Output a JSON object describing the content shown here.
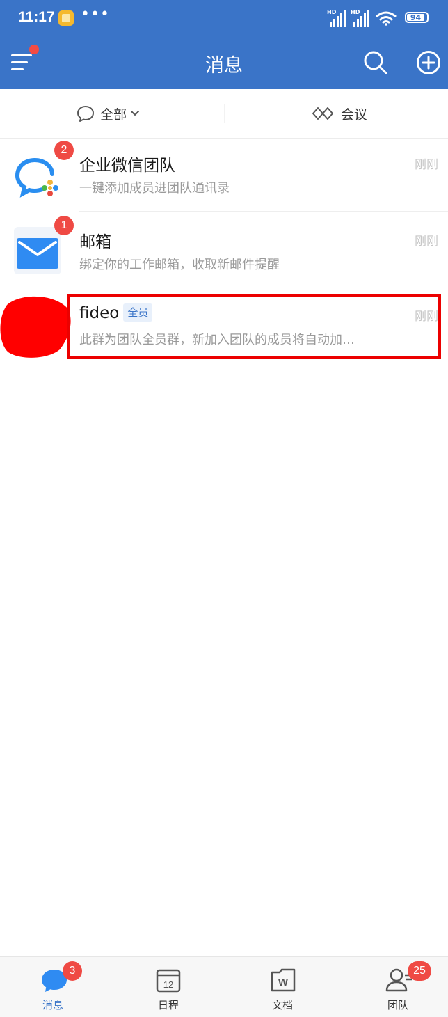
{
  "status_bar": {
    "time": "11:17",
    "dots": "•••",
    "signal_label_1": "HD",
    "signal_label_2": "HD",
    "battery": "94"
  },
  "navbar": {
    "title": "消息",
    "menu_has_dot": true
  },
  "filters": {
    "all_label": "全部",
    "meeting_label": "会议"
  },
  "messages": [
    {
      "title": "企业微信团队",
      "preview": "一键添加成员进团队通讯录",
      "time": "刚刚",
      "badge": "2",
      "icon": "wecom-logo-icon"
    },
    {
      "title": "邮箱",
      "preview": "绑定你的工作邮箱，收取新邮件提醒",
      "time": "刚刚",
      "badge": "1",
      "icon": "mail-icon"
    },
    {
      "title": "fideo",
      "tag": "全员",
      "preview": "此群为团队全员群，新加入团队的成员将自动加…",
      "time": "刚刚",
      "icon": "group-avatar"
    }
  ],
  "tabs": [
    {
      "label": "消息",
      "badge": "3",
      "active": true,
      "icon": "chat-bubble-icon"
    },
    {
      "label": "日程",
      "calendar_day": "12",
      "icon": "calendar-icon"
    },
    {
      "label": "文档",
      "doc_letter": "W",
      "icon": "document-icon"
    },
    {
      "label": "团队",
      "badge": "25",
      "icon": "contacts-icon"
    }
  ],
  "colors": {
    "brand_blue": "#3a74c8",
    "badge_red": "#ef4a44",
    "highlight_red": "#ec0000"
  }
}
